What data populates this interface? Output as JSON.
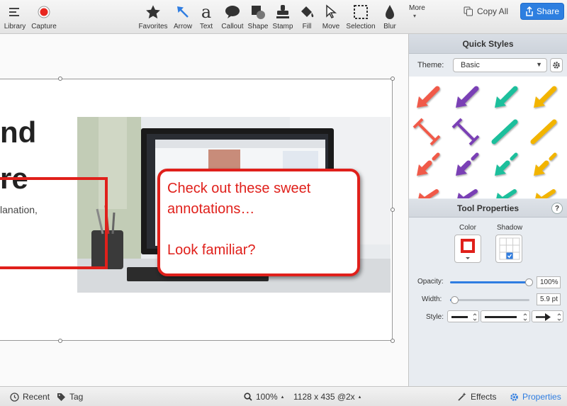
{
  "toolbar": {
    "library": "Library",
    "capture": "Capture",
    "favorites": "Favorites",
    "arrow": "Arrow",
    "text": "Text",
    "callout": "Callout",
    "shape": "Shape",
    "stamp": "Stamp",
    "fill": "Fill",
    "move": "Move",
    "selection": "Selection",
    "blur": "Blur",
    "more": "More",
    "copy_all": "Copy All",
    "share": "Share",
    "text_icon_glyph": "a"
  },
  "canvas": {
    "heading_line1": "nd",
    "heading_line2": "re",
    "body_text": "lanation,",
    "callout_text": "Check out these sweet\nannotations…\n\nLook familiar?",
    "annotation_color": "#e0201b"
  },
  "panel": {
    "quick_styles_title": "Quick Styles",
    "theme_label": "Theme:",
    "theme_value": "Basic",
    "tool_properties_title": "Tool Properties",
    "help": "?",
    "color_label": "Color",
    "shadow_label": "Shadow",
    "opacity_label": "Opacity:",
    "opacity_value": "100%",
    "opacity_fraction": 1.0,
    "width_label": "Width:",
    "width_value": "5.9 pt",
    "width_fraction": 0.06,
    "style_label": "Style:",
    "style_colors": [
      "#f05a4a",
      "#7a3fb5",
      "#1fbf9c",
      "#f2b400"
    ]
  },
  "status": {
    "recent": "Recent",
    "tag": "Tag",
    "zoom": "100%",
    "dimensions": "1128 x 435 @2x",
    "effects": "Effects",
    "properties": "Properties"
  }
}
